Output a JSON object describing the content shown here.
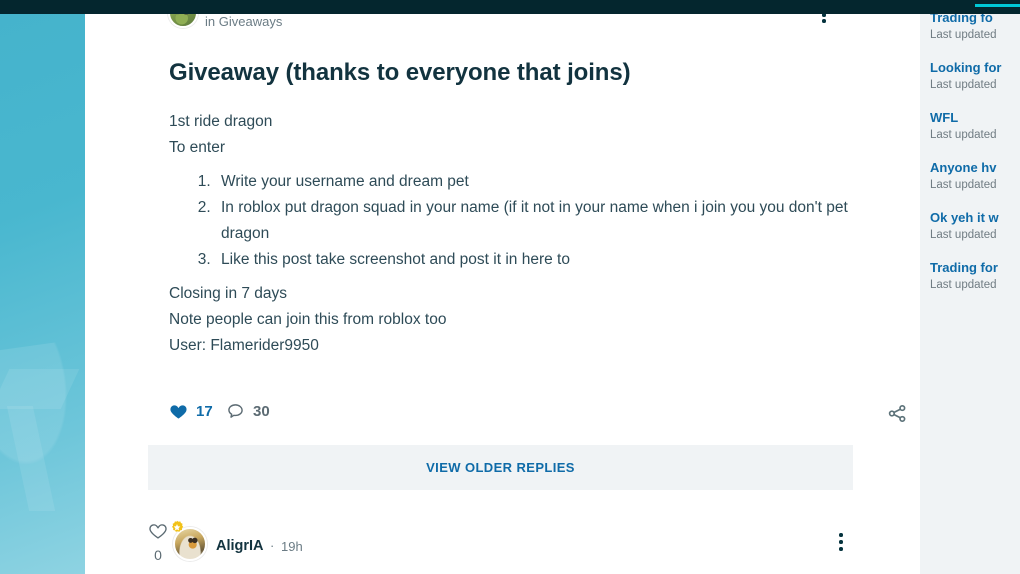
{
  "header": {
    "accent_color": "#00c8d7",
    "background_color": "#04262e"
  },
  "colors": {
    "link": "#0f6ba8",
    "title": "#12333f",
    "body": "#2e4b57",
    "muted": "#6b7c85",
    "panel_bg": "#f0f3f5",
    "left_panel": "#49b7cf"
  },
  "post": {
    "category_prefix": "in",
    "category": "Giveaways",
    "title": "Giveaway (thanks to everyone that joins)",
    "body_lines_top": [
      "1st ride dragon",
      "To enter"
    ],
    "body_list": [
      "Write your username and dream pet",
      "In roblox put dragon squad in your name (if it not in your name when i join you you don't pet dragon",
      "Like this post take screenshot and post it in here to"
    ],
    "body_lines_bottom": [
      "Closing in 7 days",
      "Note people can join this from roblox too",
      "User: Flamerider9950"
    ],
    "like_count": "17",
    "comment_count": "30",
    "options_icon": "more-vertical-icon",
    "like_icon": "heart-filled-icon",
    "comment_icon": "comment-icon",
    "share_icon": "share-icon",
    "avatar_icon": "user-avatar"
  },
  "replies_section": {
    "view_older_label": "VIEW OLDER REPLIES"
  },
  "reply": {
    "like_count": "0",
    "like_icon": "heart-outline-icon",
    "username": "AligrIA",
    "separator": "·",
    "time": "19h",
    "badge_icon": "star-badge-icon",
    "options_icon": "more-vertical-icon",
    "avatar_icon": "user-avatar"
  },
  "sidebar": {
    "meta_label": "Last updated",
    "threads": [
      {
        "title": "Trading fo",
        "meta": "Last updated"
      },
      {
        "title": "Looking for",
        "meta": "Last updated"
      },
      {
        "title": "WFL",
        "meta": "Last updated"
      },
      {
        "title": "Anyone hv",
        "meta": "Last updated"
      },
      {
        "title": "Ok yeh it w",
        "meta": "Last updated"
      },
      {
        "title": "Trading for",
        "meta": "Last updated"
      }
    ]
  }
}
